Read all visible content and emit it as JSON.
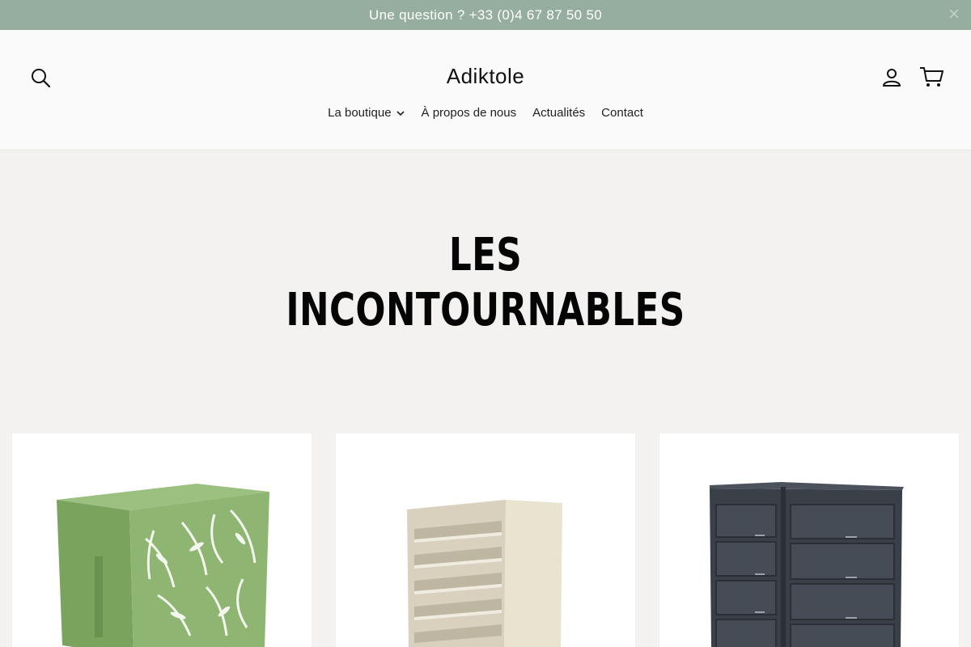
{
  "announcement": {
    "text": "Une question ? +33 (0)4 67 87 50 50"
  },
  "header": {
    "logo": "Adiktole"
  },
  "nav": {
    "items": [
      {
        "label": "La boutique",
        "has_dropdown": true
      },
      {
        "label": "À propos de nous"
      },
      {
        "label": "Actualités"
      },
      {
        "label": "Contact"
      }
    ]
  },
  "section": {
    "title_line1": "LES",
    "title_line2": "INCONTOURNABLES"
  },
  "products": [
    {
      "image": "green-aircon-cover-with-leaf-pattern",
      "color": "#8fb573"
    },
    {
      "image": "beige-louvered-aircon-cover",
      "color": "#ddd6c4"
    },
    {
      "image": "dark-grey-double-bin-storage",
      "color": "#3a4048"
    }
  ],
  "icons": {
    "search": "search-icon",
    "account": "account-icon",
    "cart": "cart-icon",
    "close": "close-icon",
    "chevron": "chevron-down-icon"
  },
  "colors": {
    "announcement_bg": "#96ae9f",
    "page_bg": "#f3f2f0",
    "header_bg": "#fafafa"
  }
}
